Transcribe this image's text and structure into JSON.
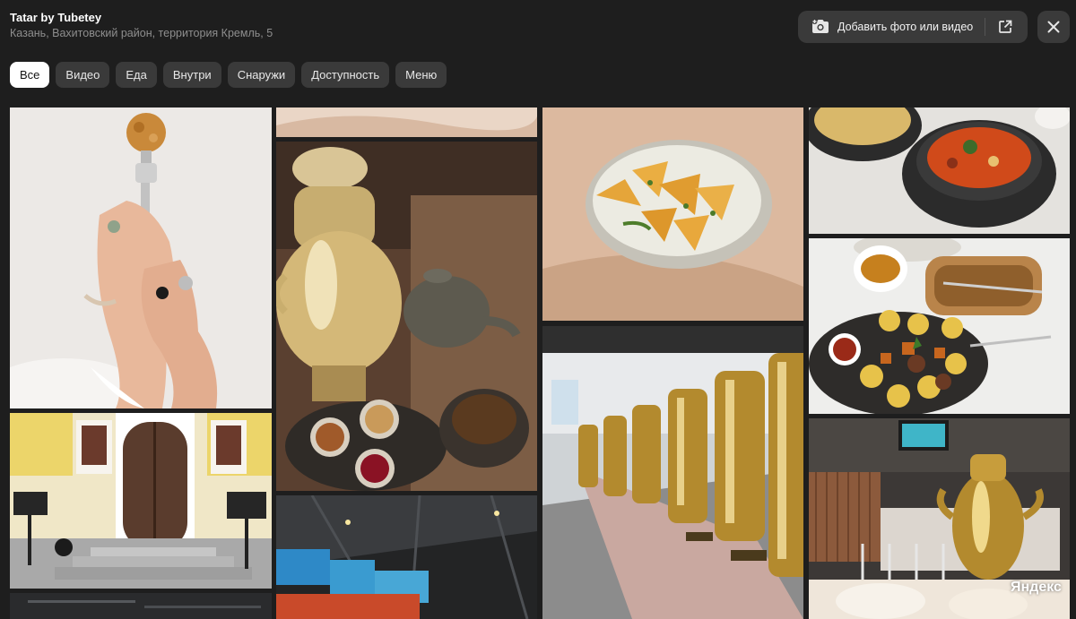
{
  "place": {
    "title": "Tatar by Tubetey",
    "address": "Казань, Вахитовский район, территория Кремль, 5"
  },
  "toolbar": {
    "add_label": "Добавить фото или видео",
    "camera_icon": "camera-plus-icon",
    "external_icon": "open-external-icon",
    "close_icon": "close-icon"
  },
  "tabs": [
    {
      "label": "Все",
      "active": true
    },
    {
      "label": "Видео",
      "active": false
    },
    {
      "label": "Еда",
      "active": false
    },
    {
      "label": "Внутри",
      "active": false
    },
    {
      "label": "Снаружи",
      "active": false
    },
    {
      "label": "Доступность",
      "active": false
    },
    {
      "label": "Меню",
      "active": false
    }
  ],
  "gallery": {
    "photos": [
      "hands-holding-chak-chak-fork",
      "building-entrance-door",
      "interior-ceiling",
      "bread-on-tablecloth",
      "samovar-with-tea-and-jam",
      "interior-menu-boards",
      "dumplings-in-bowl",
      "row-of-samovars",
      "soup-and-noodles",
      "potatoes-with-meat-plate",
      "samovar-in-cafe"
    ]
  },
  "watermark": "Яндекс",
  "colors": {
    "background": "#1e1e1e",
    "chip": "#3a3a3a",
    "chip_active": "#ffffff"
  }
}
